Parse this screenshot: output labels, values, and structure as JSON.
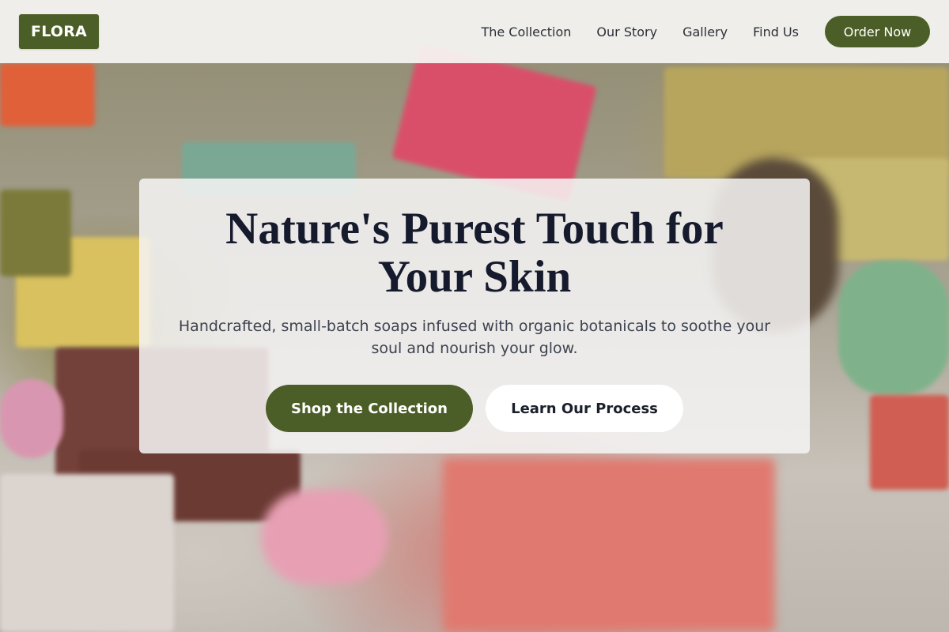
{
  "brand": {
    "logo_text": "FLORA",
    "accent_color": "#4c5e27"
  },
  "nav": {
    "links": [
      "The Collection",
      "Our Story",
      "Gallery",
      "Find Us"
    ],
    "cta_label": "Order Now"
  },
  "hero": {
    "title": "Nature's Purest Touch for Your Skin",
    "subtitle": "Handcrafted, small-batch soaps infused with organic botanicals to soothe your soul and nourish your glow.",
    "primary_button": "Shop the Collection",
    "secondary_button": "Learn Our Process",
    "background_image": "blurred photo of colorful handmade soap bars with sprinkles and meringues"
  }
}
